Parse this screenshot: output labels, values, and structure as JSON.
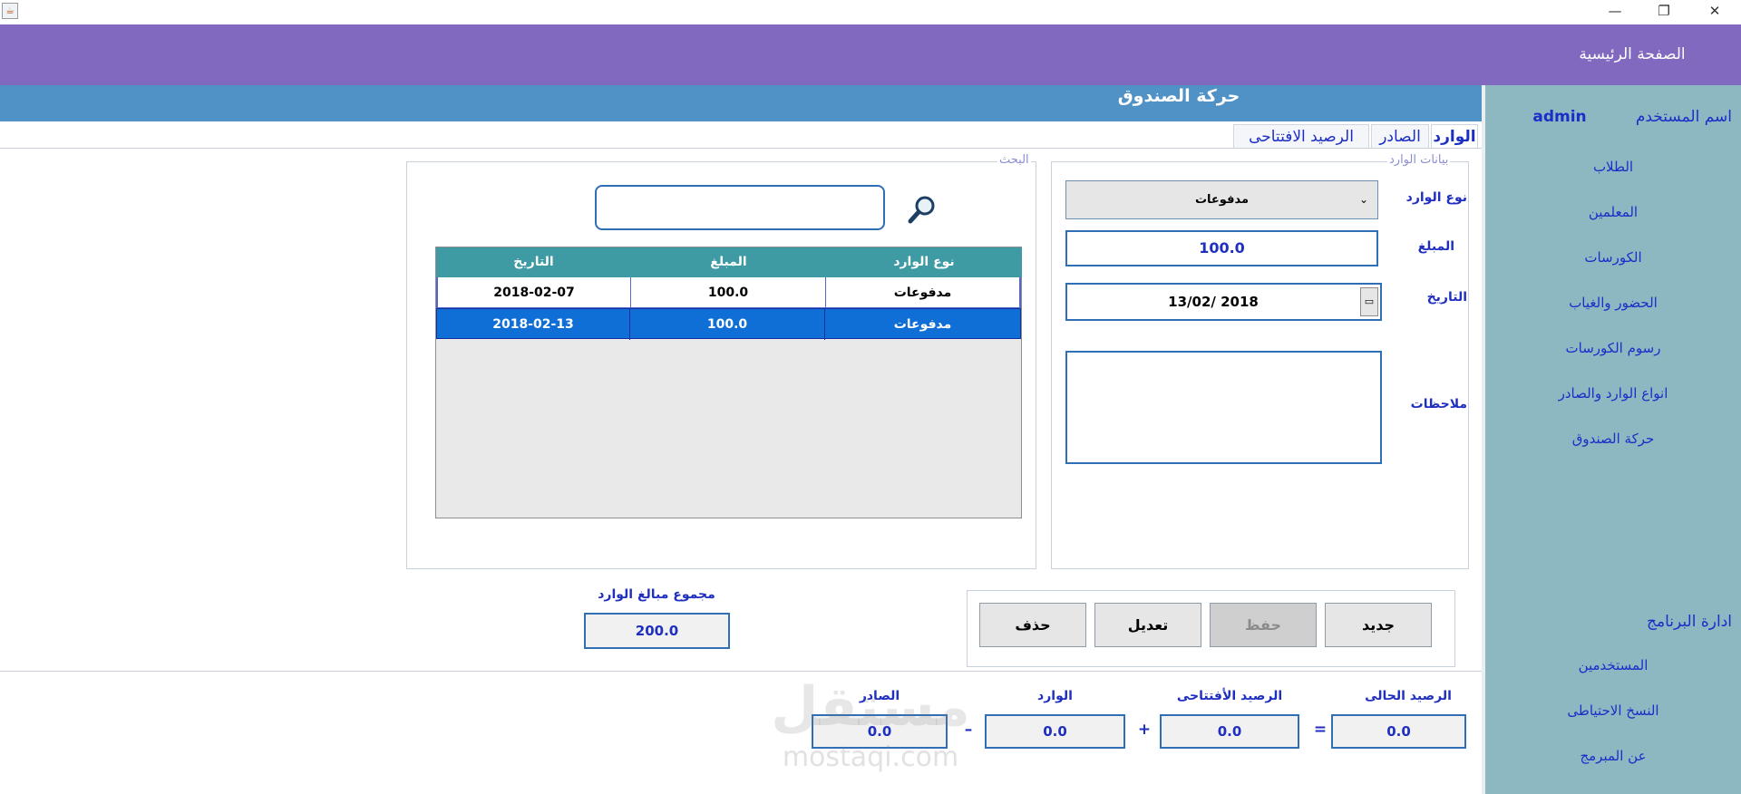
{
  "window": {
    "minimize": "—",
    "restore": "❐",
    "close": "✕"
  },
  "header": {
    "home": "الصفحة الرئيسية"
  },
  "sidebar": {
    "user_label": "اسم المستخدم",
    "user_value": "admin",
    "items": [
      "الطلاب",
      "المعلمين",
      "الكورسات",
      "الحضور والغياب",
      "رسوم الكورسات",
      "انواع الوارد والصادر",
      "حركة الصندوق"
    ],
    "admin_title": "ادارة البرنامج",
    "admin_items": [
      "المستخدمين",
      "النسخ الاحتياطى",
      "عن المبرمج"
    ]
  },
  "module": {
    "title": "حركة الصندوق"
  },
  "tabs": [
    "الوارد",
    "الصادر",
    "الرصيد الافتتاحى"
  ],
  "form": {
    "legend": "بيانات الوارد",
    "type_label": "نوع الوارد",
    "type_value": "مدفوعات",
    "amount_label": "المبلغ",
    "amount_value": "100.0",
    "date_label": "التاريخ",
    "date_value": "13/02/ 2018",
    "notes_label": "ملاحظات",
    "notes_value": ""
  },
  "search": {
    "legend": "البحث",
    "value": "",
    "headers": [
      "نوع الوارد",
      "المبلغ",
      "التاريخ"
    ],
    "rows": [
      [
        "مدفوعات",
        "100.0",
        "2018-02-07"
      ],
      [
        "مدفوعات",
        "100.0",
        "2018-02-13"
      ]
    ],
    "selected_row": 1
  },
  "actions": {
    "new": "جديد",
    "save": "حفظ",
    "edit": "تعديل",
    "delete": "حذف"
  },
  "total": {
    "label": "مجموع مبالغ الوارد",
    "value": "200.0"
  },
  "balance": {
    "current_label": "الرصيد الحالى",
    "current_value": "0.0",
    "opening_label": "الرصيد الأفتتاحى",
    "opening_value": "0.0",
    "income_label": "الوارد",
    "income_value": "0.0",
    "expense_label": "الصادر",
    "expense_value": "0.0",
    "eq": "=",
    "plus": "+",
    "minus": "–"
  },
  "watermark": {
    "text": "mostaqi.com",
    "logo_text": "مستقل"
  },
  "colors": {
    "header": "#8069bf",
    "sidebar": "#8db8c2",
    "module_bar": "#5192c6",
    "table_header": "#3e9aa3",
    "selection": "#0f6fd6",
    "link": "#1a2ec8"
  }
}
